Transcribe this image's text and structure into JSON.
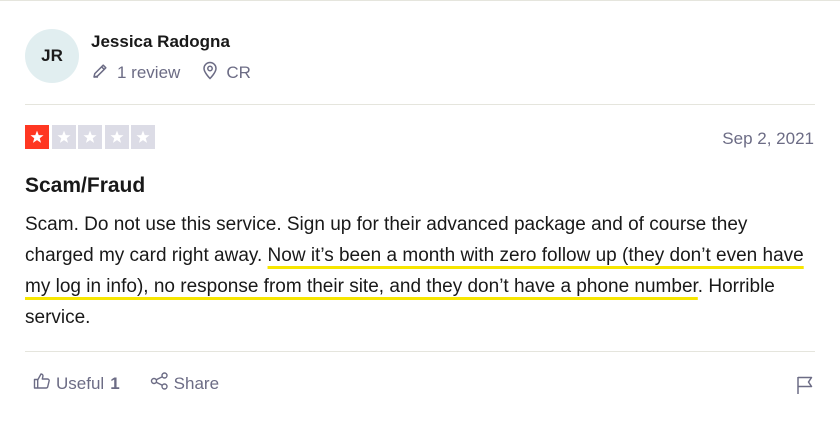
{
  "reviewer": {
    "initials": "JR",
    "name": "Jessica Radogna",
    "review_count": "1 review",
    "country": "CR"
  },
  "review": {
    "rating": 1,
    "rating_max": 5,
    "date": "Sep 2, 2021",
    "title": "Scam/Fraud",
    "body_part1": "Scam. Do not use this service. Sign up for their advanced package and of course they charged my card right away. ",
    "body_highlight": "Now it’s been a month with zero follow up (they don’t even have my log in info), no response from their site, and they don’t have a phone number",
    "body_part2": ". Horrible service."
  },
  "actions": {
    "useful_label": "Useful",
    "useful_count": "1",
    "share_label": "Share"
  },
  "colors": {
    "star_filled": "#ff3722",
    "star_empty": "#dcdce6",
    "highlight": "#f7e600",
    "muted_text": "#6c6c85"
  }
}
